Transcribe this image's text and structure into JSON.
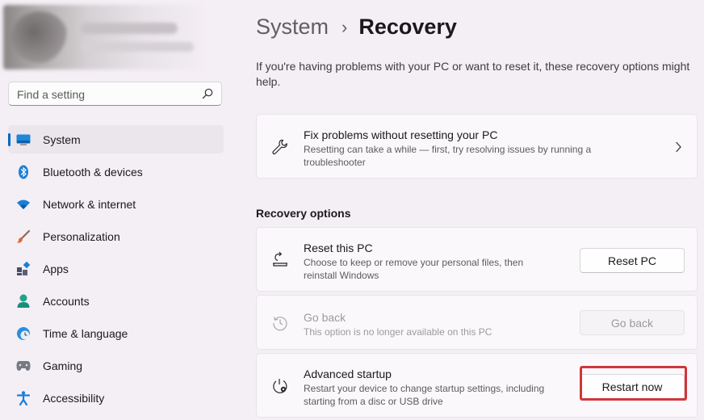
{
  "search": {
    "placeholder": "Find a setting"
  },
  "sidebar": {
    "items": [
      {
        "label": "System",
        "icon": "system-icon",
        "active": true
      },
      {
        "label": "Bluetooth & devices",
        "icon": "bluetooth-icon"
      },
      {
        "label": "Network & internet",
        "icon": "wifi-icon"
      },
      {
        "label": "Personalization",
        "icon": "brush-icon"
      },
      {
        "label": "Apps",
        "icon": "apps-icon"
      },
      {
        "label": "Accounts",
        "icon": "accounts-icon"
      },
      {
        "label": "Time & language",
        "icon": "globe-clock-icon"
      },
      {
        "label": "Gaming",
        "icon": "gamepad-icon"
      },
      {
        "label": "Accessibility",
        "icon": "accessibility-icon"
      }
    ]
  },
  "header": {
    "parent": "System",
    "separator": "›",
    "current": "Recovery"
  },
  "description": "If you're having problems with your PC or want to reset it, these recovery options might help.",
  "fix_card": {
    "title": "Fix problems without resetting your PC",
    "subtitle": "Resetting can take a while — first, try resolving issues by running a troubleshooter",
    "icon": "wrench-icon"
  },
  "recovery_options": {
    "heading": "Recovery options",
    "items": [
      {
        "title": "Reset this PC",
        "subtitle": "Choose to keep or remove your personal files, then reinstall Windows",
        "button": "Reset PC",
        "icon": "reset-pc-icon",
        "enabled": true
      },
      {
        "title": "Go back",
        "subtitle": "This option is no longer available on this PC",
        "button": "Go back",
        "icon": "history-icon",
        "enabled": false
      },
      {
        "title": "Advanced startup",
        "subtitle": "Restart your device to change startup settings, including starting from a disc or USB drive",
        "button": "Restart now",
        "icon": "advanced-startup-icon",
        "enabled": true
      }
    ]
  },
  "colors": {
    "accent": "#0067c0",
    "highlight": "#d0363a",
    "background": "#f4eef5"
  }
}
